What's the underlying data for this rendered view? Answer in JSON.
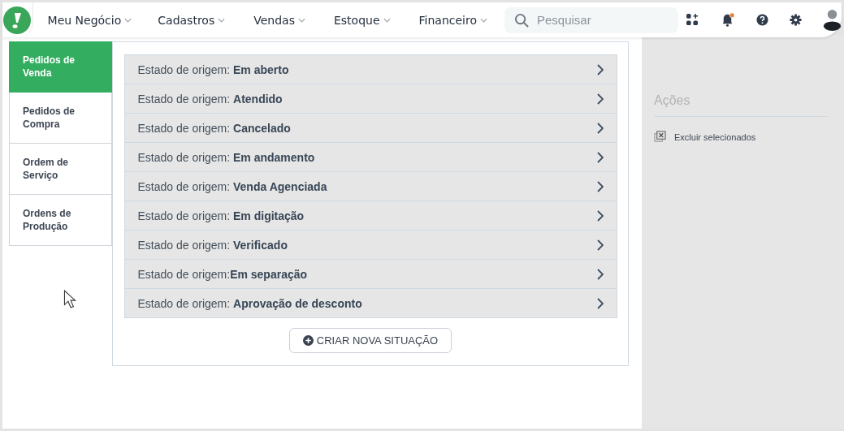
{
  "nav": {
    "menus": [
      {
        "label": "Meu Negócio"
      },
      {
        "label": "Cadastros"
      },
      {
        "label": "Vendas"
      },
      {
        "label": "Estoque"
      },
      {
        "label": "Financeiro"
      }
    ],
    "search": {
      "placeholder": "Pesquisar"
    }
  },
  "sidebar": {
    "items": [
      {
        "label": "Pedidos de Venda",
        "selected": true
      },
      {
        "label": "Pedidos de Compra",
        "selected": false
      },
      {
        "label": "Ordem de Serviço",
        "selected": false
      },
      {
        "label": "Ordens de Produção",
        "selected": false
      }
    ]
  },
  "states": [
    {
      "text": "Estado de origem: **Em aberto**"
    },
    {
      "text": "Estado de origem: **Atendido**"
    },
    {
      "text": "Estado de origem: **Cancelado**"
    },
    {
      "text": "Estado de origem: **Em andamento**"
    },
    {
      "text": "Estado de origem: **Venda Agenciada**"
    },
    {
      "text": "Estado de origem: **Em digitação**"
    },
    {
      "text": "Estado de origem: **Verificado**"
    },
    {
      "text": "Estado de origem:**Em separação**"
    },
    {
      "text": "Estado de origem: **Aprovação de desconto**"
    }
  ],
  "create_button": "CRIAR NOVA SITUAÇÃO",
  "actions": {
    "title": "Ações",
    "items": [
      "Excluir selecionados"
    ]
  }
}
